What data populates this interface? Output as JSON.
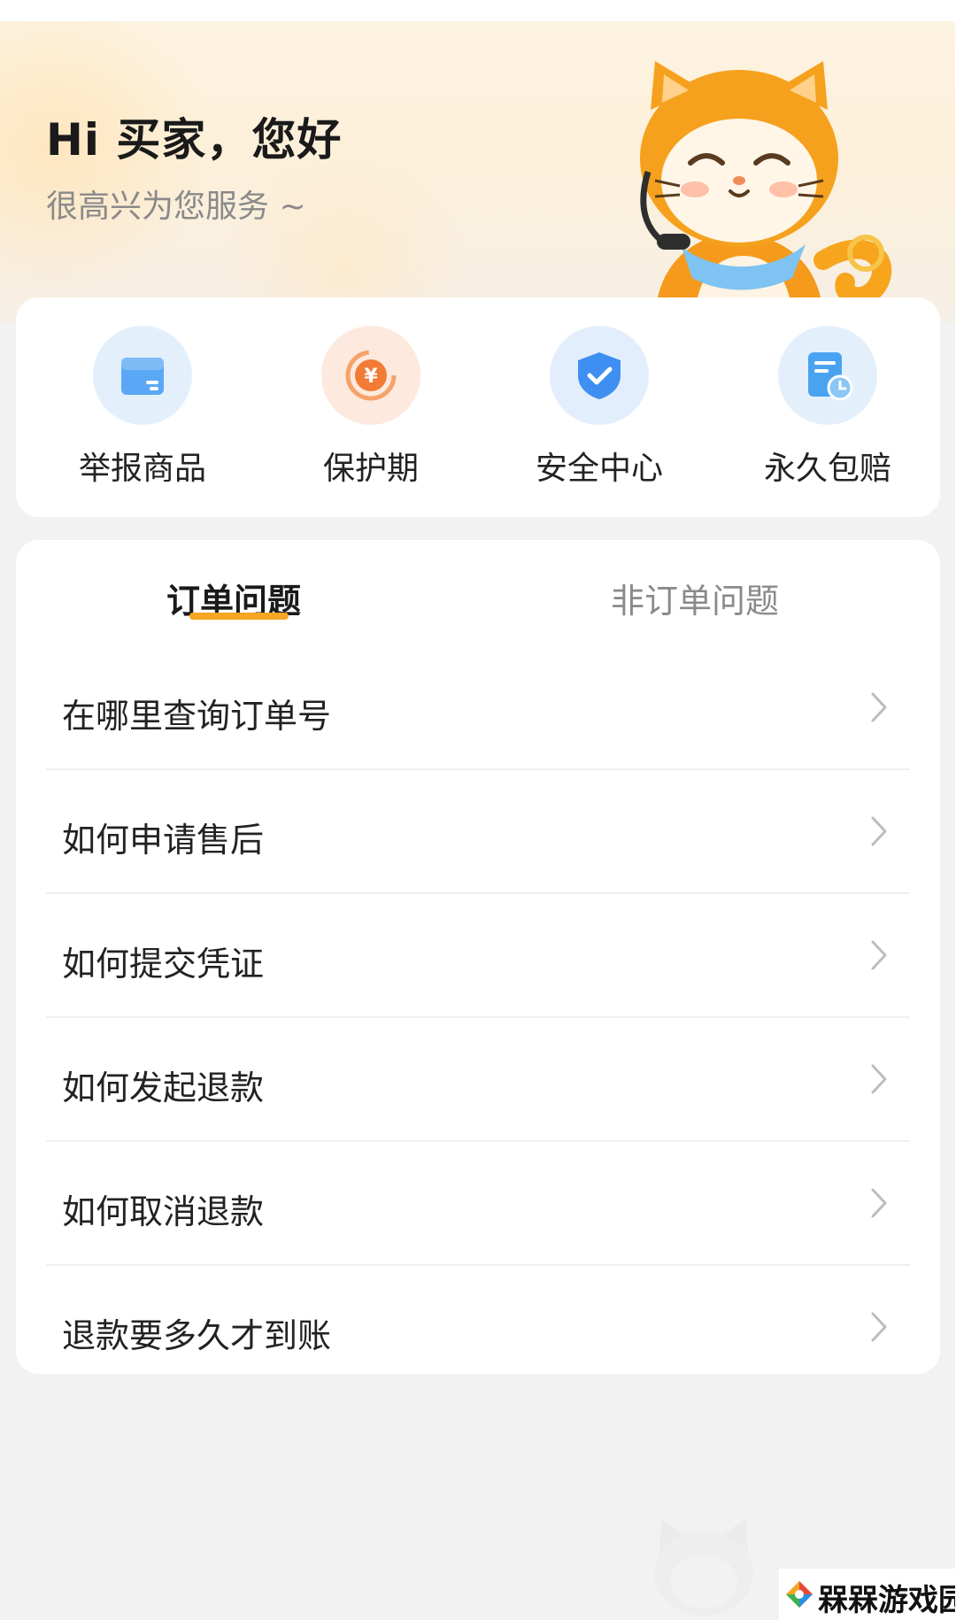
{
  "hero": {
    "title": "Hi 买家，您好",
    "subtitle": "很高兴为您服务 ~"
  },
  "quick_actions": [
    {
      "label": "举报商品",
      "icon": "report-goods-icon",
      "color": "#5aa8f5"
    },
    {
      "label": "保护期",
      "icon": "yuan-refresh-icon",
      "color": "#f27b35"
    },
    {
      "label": "安全中心",
      "icon": "shield-check-icon",
      "color": "#3f8ff2"
    },
    {
      "label": "永久包赔",
      "icon": "document-clock-icon",
      "color": "#4aa3f0"
    }
  ],
  "tabs": [
    {
      "label": "订单问题",
      "active": true
    },
    {
      "label": "非订单问题",
      "active": false
    }
  ],
  "faq_items": [
    {
      "label": "在哪里查询订单号"
    },
    {
      "label": "如何申请售后"
    },
    {
      "label": "如何提交凭证"
    },
    {
      "label": "如何发起退款"
    },
    {
      "label": "如何取消退款"
    },
    {
      "label": "退款要多久才到账"
    }
  ],
  "watermark": {
    "text": "槑槑游戏园"
  },
  "colors": {
    "accent": "#f5a623",
    "background": "#f2f2f2",
    "card": "#ffffff"
  }
}
